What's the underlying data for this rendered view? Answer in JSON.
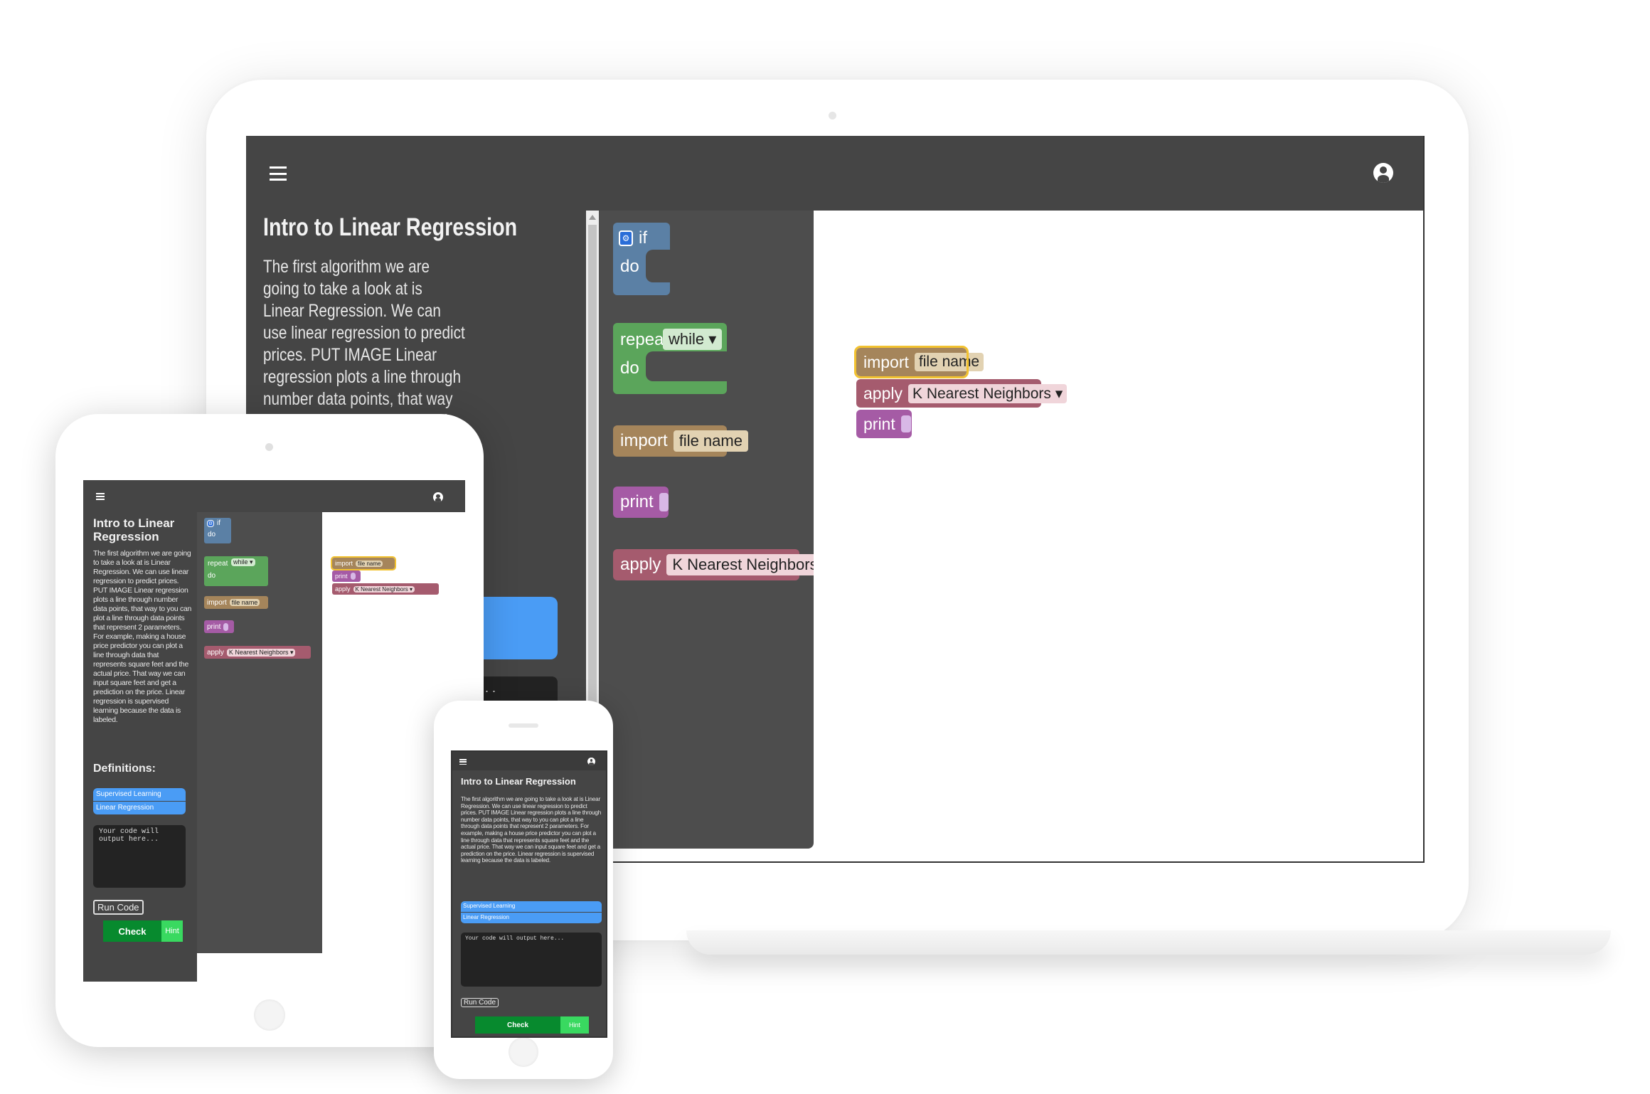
{
  "app": {
    "lesson_title": "Intro to Linear Regression",
    "lesson_body": "The first algorithm we are going to take a look at is Linear Regression. We can use linear regression to predict prices. PUT IMAGE Linear regression plots a line through number data points, that way to you can plot a line through data points that represent 2 parameters. For example, making a house price predictor you can plot a line through data that represents square feet and the actual price. That way we can input square feet and get a prediction on the price. Linear regression is supervised learning because the data is labeled.",
    "definitions_heading": "Definitions:",
    "definitions": [
      "Supervised Learning",
      "Linear Regression"
    ],
    "output_placeholder": "Your code will output here...",
    "run_label": "Run Code",
    "check_label": "Check",
    "hint_label": "Hint",
    "icons": {
      "menu": "menu-icon",
      "account": "account-icon"
    }
  },
  "toolbox": {
    "if_label": "if",
    "do_label": "do",
    "repeat_label": "repeat",
    "while_label": "while",
    "import_label": "import",
    "file_name": "file name",
    "print_label": "print",
    "apply_label": "apply",
    "knn_label": "K Nearest Neighbors"
  },
  "laptop_extra": {
    "ellipsis": ". . ."
  },
  "colors": {
    "appbar": "#454545",
    "if_block": "#5b80a5",
    "repeat_block": "#5ba55b",
    "import_block": "#a5855b",
    "print_block": "#a55ba5",
    "apply_block": "#a55b6e",
    "selected_outline": "#f2c230",
    "definition_bg": "#4a9cf5",
    "check_bg": "#078a2e",
    "hint_bg": "#39d960"
  }
}
